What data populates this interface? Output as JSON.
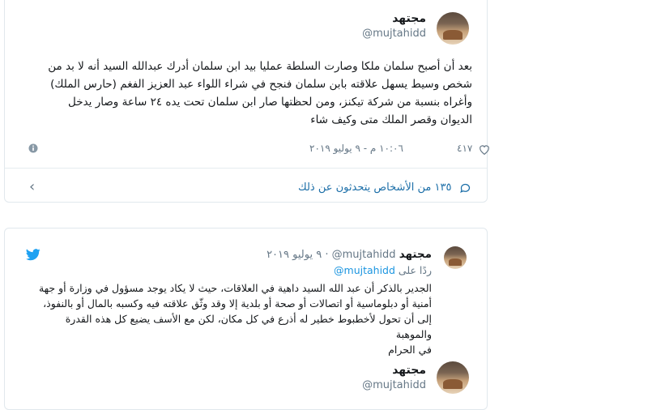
{
  "tweet1": {
    "author_name": "مجتهد",
    "author_handle": "@mujtahidd",
    "text": "بعد أن أصبح سلمان ملكا وصارت السلطة عمليا بيد ابن سلمان أدرك عبدالله السيد أنه لا بد من\nشخص وسيط يسهل علاقته بابن سلمان فنجح في شراء اللواء عبد العزيز الفغم (حارس الملك)\nوأغراه بنسبة من شركة تيكنز، ومن لحظتها صار ابن سلمان تحت يده ٢٤ ساعة وصار يدخل\nالديوان وقصر الملك متى وكيف شاء",
    "likes": "٤١٧",
    "timestamp": "١٠:٠٦ م - ٩ يوليو ٢٠١٩",
    "talk_link": "١٣٥ من الأشخاص يتحدثون عن ذلك"
  },
  "tweet2": {
    "author_name": "مجتهد",
    "author_handle": "@mujtahidd",
    "date": "· ٩ يوليو ٢٠١٩",
    "reply_prefix": "ردًا على",
    "reply_handle": "@mujtahidd",
    "text": "الجدير بالذكر أن عبد الله السيد داهية في العلاقات، حيث لا يكاد يوجد مسؤول في وزارة أو جهة\nأمنية أو دبلوماسية أو اتصالات أو صحة أو بلدية إلا وقد وثّق علاقته فيه وكسبه بالمال أو بالنفوذ،\nإلى أن تحول لأخطبوط خطير له أذرع في كل مكان، لكن مع الأسف يضيع كل هذه القدرة والموهبة\nفي الحرام"
  },
  "tweet3": {
    "author_name": "مجتهد",
    "author_handle": "@mujtahidd"
  },
  "colors": {
    "link_blue": "#1b6ea8",
    "twitter_blue": "#1da1f2",
    "muted": "#657786",
    "border": "#e1e8ed"
  },
  "icons": [
    "heart-icon",
    "info-icon",
    "chat-bubble-icon",
    "chevron-left-icon",
    "twitter-bird-icon"
  ]
}
